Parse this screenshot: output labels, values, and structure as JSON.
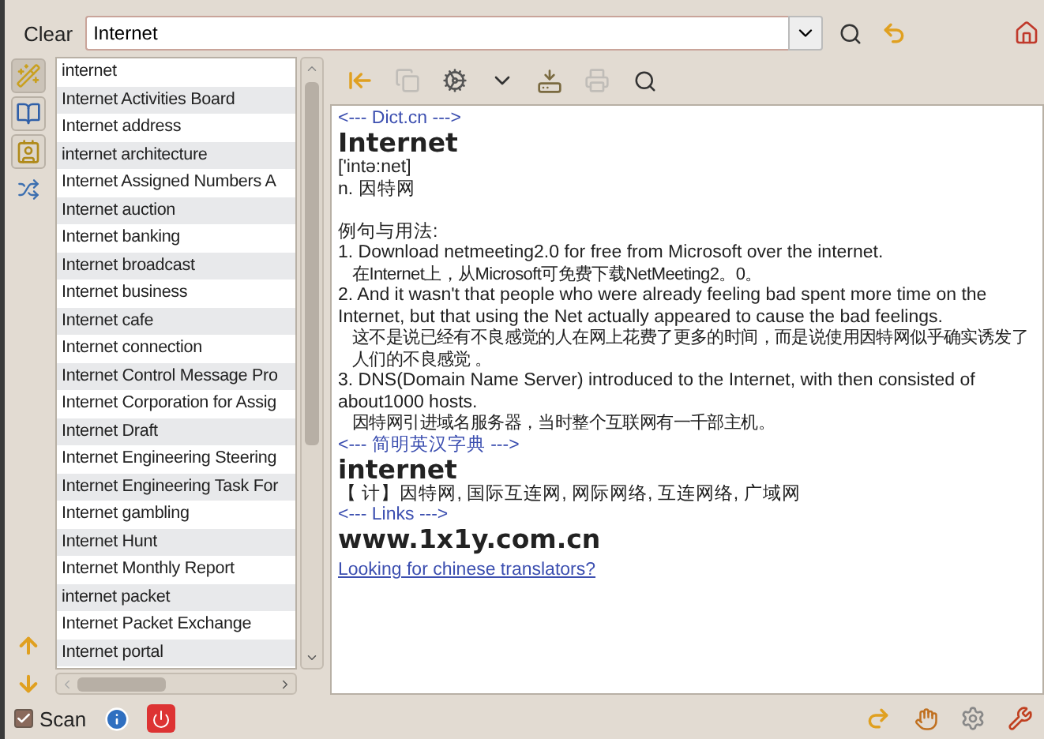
{
  "search": {
    "clear_label": "Clear",
    "value": "Internet"
  },
  "side_tools": [
    {
      "kind": "wand",
      "selected": true
    },
    {
      "kind": "book",
      "selected": false
    },
    {
      "kind": "card",
      "selected": false
    },
    {
      "kind": "swap",
      "selected": false
    }
  ],
  "word_list": [
    {
      "text": "internet",
      "selected": false
    },
    {
      "text": "Internet Activities Board",
      "selected": false
    },
    {
      "text": "Internet address",
      "selected": false
    },
    {
      "text": "internet architecture",
      "selected": false
    },
    {
      "text": "Internet Assigned Numbers A",
      "selected": false
    },
    {
      "text": "Internet auction",
      "selected": false
    },
    {
      "text": "Internet banking",
      "selected": false
    },
    {
      "text": "Internet broadcast",
      "selected": false
    },
    {
      "text": "Internet business",
      "selected": false
    },
    {
      "text": "Internet cafe",
      "selected": false
    },
    {
      "text": "Internet connection",
      "selected": false
    },
    {
      "text": "Internet Control Message Pro",
      "selected": false
    },
    {
      "text": "Internet Corporation for Assig",
      "selected": false
    },
    {
      "text": "Internet Draft",
      "selected": false
    },
    {
      "text": "Internet Engineering Steering",
      "selected": false
    },
    {
      "text": "Internet Engineering Task For",
      "selected": false
    },
    {
      "text": "Internet gambling",
      "selected": false
    },
    {
      "text": "Internet Hunt",
      "selected": false
    },
    {
      "text": "Internet Monthly Report",
      "selected": false
    },
    {
      "text": "internet packet",
      "selected": false
    },
    {
      "text": "Internet Packet Exchange",
      "selected": false
    },
    {
      "text": "Internet portal",
      "selected": false
    }
  ],
  "toolbar": [
    {
      "kind": "first",
      "disabled": false
    },
    {
      "kind": "copy",
      "disabled": true
    },
    {
      "kind": "gears",
      "disabled": false
    },
    {
      "kind": "dropdown",
      "disabled": false
    },
    {
      "kind": "save",
      "disabled": false
    },
    {
      "kind": "print",
      "disabled": true
    },
    {
      "kind": "find",
      "disabled": false
    }
  ],
  "content": [
    {
      "kind": "source",
      "text": "<--- Dict.cn --->"
    },
    {
      "kind": "headword",
      "text": "Internet"
    },
    {
      "kind": "text",
      "text": "['intə:net]"
    },
    {
      "kind": "text",
      "text": "n. 因特网"
    },
    {
      "kind": "blank"
    },
    {
      "kind": "text",
      "text": "例句与用法:"
    },
    {
      "kind": "text",
      "text": "1. Download netmeeting2.0 for free from Microsoft over the internet."
    },
    {
      "kind": "indent",
      "text": "在Internet上，从Microsoft可免费下载NetMeeting2。0。"
    },
    {
      "kind": "text",
      "text": "2. And it wasn't that people who were already feeling bad spent more time on the Internet, but that using the Net actually appeared to cause the bad feelings."
    },
    {
      "kind": "indent",
      "text": "这不是说已经有不良感觉的人在网上花费了更多的时间，而是说使用因特网似乎确实诱发了人们的不良感觉 。"
    },
    {
      "kind": "text",
      "text": "3. DNS(Domain Name Server) introduced to the Internet, with then consisted of about1000 hosts."
    },
    {
      "kind": "indent",
      "text": "因特网引进域名服务器，当时整个互联网有一千部主机。"
    },
    {
      "kind": "source",
      "text": "<--- 简明英汉字典 --->"
    },
    {
      "kind": "headword",
      "text": "internet"
    },
    {
      "kind": "text",
      "text": "【 计】因特网, 国际互连网, 网际网络, 互连网络, 广域网"
    },
    {
      "kind": "source",
      "text": "<--- Links --->"
    },
    {
      "kind": "headword",
      "text": "www.1x1y.com.cn"
    },
    {
      "kind": "link",
      "text": "Looking for chinese translators?"
    }
  ],
  "status_bar": {
    "scan_label": "Scan",
    "scan_checked": true
  }
}
